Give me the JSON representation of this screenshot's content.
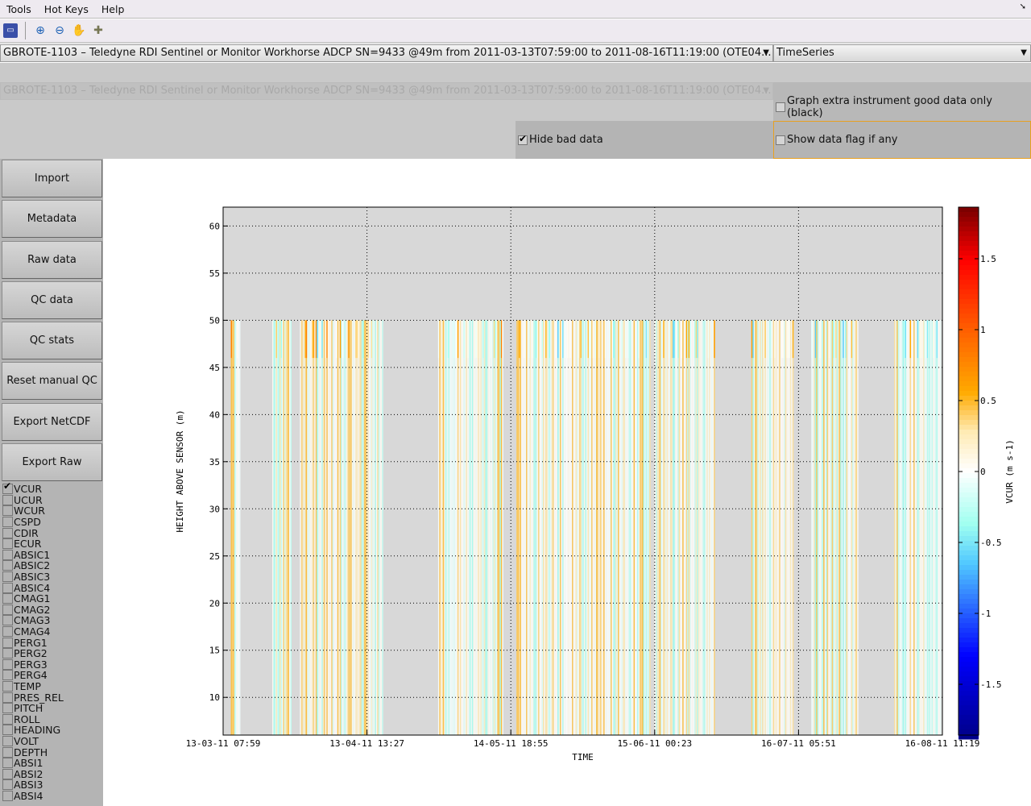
{
  "menu": {
    "items": [
      "Tools",
      "Hot Keys",
      "Help"
    ]
  },
  "toolbar": {
    "icons": [
      "save-icon",
      "zoom-in-icon",
      "zoom-out-icon",
      "pan-hand-icon",
      "data-cursor-icon"
    ]
  },
  "dataset_select": {
    "value": "GBROTE-1103 – Teledyne RDI Sentinel or Monitor Workhorse ADCP SN=9433 @49m from 2011-03-13T07:59:00 to 2011-08-16T11:19:00 (OTE04..."
  },
  "graph_select": {
    "value": "TimeSeries"
  },
  "extra_dataset_select": {
    "value": "GBROTE-1103 – Teledyne RDI Sentinel or Monitor Workhorse ADCP SN=9433 @49m from 2011-03-13T07:59:00 to 2011-08-16T11:19:00 (OTE04..."
  },
  "options": {
    "graph_extra": {
      "label": "Graph extra instrument good data only (black)",
      "checked": false
    },
    "hide_bad": {
      "label": "Hide bad data",
      "checked": true
    },
    "show_flag": {
      "label": "Show data flag if any",
      "checked": false
    }
  },
  "buttons": [
    "Import",
    "Metadata",
    "Raw data",
    "QC data",
    "QC stats",
    "Reset manual QC",
    "Export NetCDF",
    "Export Raw"
  ],
  "variables": [
    {
      "name": "VCUR",
      "checked": true
    },
    {
      "name": "UCUR",
      "checked": false
    },
    {
      "name": "WCUR",
      "checked": false
    },
    {
      "name": "CSPD",
      "checked": false
    },
    {
      "name": "CDIR",
      "checked": false
    },
    {
      "name": "ECUR",
      "checked": false
    },
    {
      "name": "ABSIC1",
      "checked": false
    },
    {
      "name": "ABSIC2",
      "checked": false
    },
    {
      "name": "ABSIC3",
      "checked": false
    },
    {
      "name": "ABSIC4",
      "checked": false
    },
    {
      "name": "CMAG1",
      "checked": false
    },
    {
      "name": "CMAG2",
      "checked": false
    },
    {
      "name": "CMAG3",
      "checked": false
    },
    {
      "name": "CMAG4",
      "checked": false
    },
    {
      "name": "PERG1",
      "checked": false
    },
    {
      "name": "PERG2",
      "checked": false
    },
    {
      "name": "PERG3",
      "checked": false
    },
    {
      "name": "PERG4",
      "checked": false
    },
    {
      "name": "TEMP",
      "checked": false
    },
    {
      "name": "PRES_REL",
      "checked": false
    },
    {
      "name": "PITCH",
      "checked": false
    },
    {
      "name": "ROLL",
      "checked": false
    },
    {
      "name": "HEADING",
      "checked": false
    },
    {
      "name": "VOLT",
      "checked": false
    },
    {
      "name": "DEPTH",
      "checked": false
    },
    {
      "name": "ABSI1",
      "checked": false
    },
    {
      "name": "ABSI2",
      "checked": false
    },
    {
      "name": "ABSI3",
      "checked": false
    },
    {
      "name": "ABSI4",
      "checked": false
    }
  ],
  "chart_data": {
    "type": "heatmap",
    "xlabel": "TIME",
    "ylabel": "HEIGHT ABOVE SENSOR (m)",
    "xlim": [
      "2011-03-13T07:59",
      "2011-08-16T11:19"
    ],
    "xticks": [
      "13-03-11 07:59",
      "13-04-11 13:27",
      "14-05-11 18:55",
      "15-06-11 00:23",
      "16-07-11 05:51",
      "16-08-11 11:19"
    ],
    "ylim": [
      6,
      62
    ],
    "yticks": [
      10,
      15,
      20,
      25,
      30,
      35,
      40,
      45,
      50,
      55,
      60
    ],
    "grid": true,
    "data_height_range": [
      6,
      50
    ],
    "good_data_segments": [
      [
        "2011-03-15",
        "2011-03-17"
      ],
      [
        "2011-03-24",
        "2011-03-28"
      ],
      [
        "2011-03-30",
        "2011-04-17"
      ],
      [
        "2011-04-29",
        "2011-05-13"
      ],
      [
        "2011-05-16",
        "2011-06-14"
      ],
      [
        "2011-06-15",
        "2011-06-28"
      ],
      [
        "2011-07-06",
        "2011-07-15"
      ],
      [
        "2011-07-19",
        "2011-07-29"
      ],
      [
        "2011-08-06",
        "2011-08-16"
      ]
    ],
    "colorbar": {
      "label": "VCUR (m s-1)",
      "clim": [
        -1.86,
        1.86
      ],
      "ticks": [
        "-1.5",
        "-1",
        "-0.5",
        "0",
        "0.5",
        "1",
        "1.5"
      ],
      "colormap": "blue-cyan-white-orange-red"
    },
    "colors": {
      "axes_bg": "#d8d8d8"
    }
  }
}
